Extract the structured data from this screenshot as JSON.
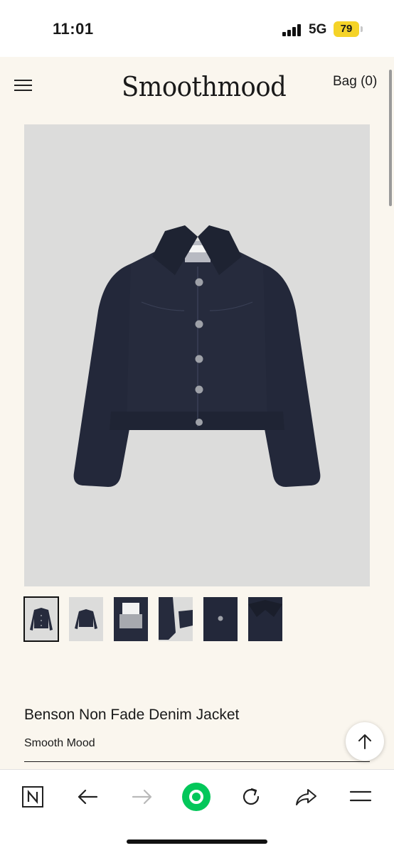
{
  "status_bar": {
    "time": "11:01",
    "network": "5G",
    "battery": "79",
    "battery_color": "#f5d328"
  },
  "header": {
    "logo": "Smoothmood",
    "bag_label": "Bag (0)",
    "menu_icon": "hamburger-menu-icon"
  },
  "gallery": {
    "main_image": "denim-jacket-front-photo",
    "thumbnails": [
      {
        "label": "jacket-front"
      },
      {
        "label": "jacket-back"
      },
      {
        "label": "collar-label-detail"
      },
      {
        "label": "sleeve-detail"
      },
      {
        "label": "button-detail"
      },
      {
        "label": "collar-detail"
      }
    ],
    "active_index": 0
  },
  "product": {
    "title": "Benson Non Fade Denim Jacket",
    "brand": "Smooth Mood"
  },
  "scroll_top_icon": "arrow-up-icon",
  "toolbar": {
    "icons": [
      "naver-logo-icon",
      "back-arrow-icon",
      "forward-arrow-icon",
      "green-home-icon",
      "refresh-icon",
      "share-icon",
      "menu-icon"
    ],
    "accent": "#03c75a"
  }
}
